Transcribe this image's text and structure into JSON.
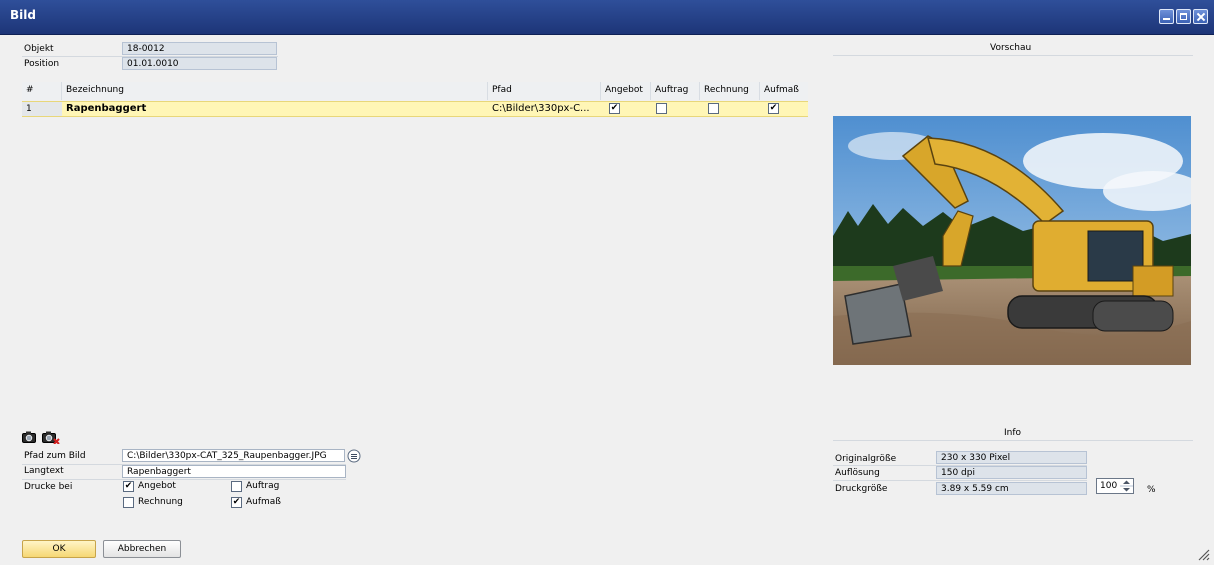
{
  "window": {
    "title": "Bild",
    "minimize_icon": "minimize-icon",
    "maximize_icon": "maximize-icon",
    "close_icon": "close-icon"
  },
  "header": {
    "objekt_label": "Objekt",
    "objekt_value": "18-0012",
    "position_label": "Position",
    "position_value": "01.01.0010"
  },
  "table": {
    "columns": [
      "#",
      "Bezeichnung",
      "Pfad",
      "Angebot",
      "Auftrag",
      "Rechnung",
      "Aufmaß"
    ],
    "rows": [
      {
        "num": "1",
        "bezeichnung": "Rapenbaggert",
        "pfad": "C:\\Bilder\\330px-C...",
        "angebot": true,
        "auftrag": false,
        "rechnung": false,
        "aufmass": true
      }
    ]
  },
  "detail": {
    "pfad_label": "Pfad zum Bild",
    "pfad_value": "C:\\Bilder\\330px-CAT_325_Raupenbagger.JPG",
    "langtext_label": "Langtext",
    "langtext_value": "Rapenbaggert",
    "drucke_label": "Drucke bei",
    "opt_angebot": "Angebot",
    "opt_auftrag": "Auftrag",
    "opt_rechnung": "Rechnung",
    "opt_aufmass": "Aufmaß",
    "angebot_checked": true,
    "auftrag_checked": false,
    "rechnung_checked": false,
    "aufmass_checked": true,
    "icons": [
      "camera-add-icon",
      "camera-delete-icon",
      "browse-icon"
    ]
  },
  "preview": {
    "title": "Vorschau",
    "image": "excavator-photo"
  },
  "info": {
    "title": "Info",
    "original_label": "Originalgröße",
    "original_value": "230 x 330 Pixel",
    "aufloesung_label": "Auflösung",
    "aufloesung_value": "150 dpi",
    "druck_label": "Druckgröße",
    "druck_value": "3.89 x 5.59 cm",
    "zoom_value": "100",
    "zoom_unit": "%"
  },
  "buttons": {
    "ok": "OK",
    "cancel": "Abbrechen"
  },
  "colors": {
    "titlebar": "#1d3578",
    "selected_row": "#fff6b6",
    "ok_button": "#f6d774"
  }
}
